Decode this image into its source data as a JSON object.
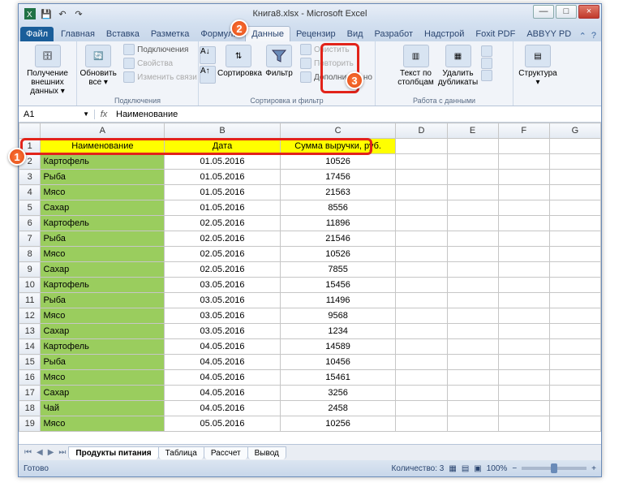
{
  "titlebar": {
    "title": "Книга8.xlsx - Microsoft Excel"
  },
  "winbuttons": {
    "min": "—",
    "max": "□",
    "close": "×"
  },
  "tabs": {
    "file": "Файл",
    "items": [
      "Главная",
      "Вставка",
      "Разметка",
      "Формулы",
      "Данные",
      "Рецензир",
      "Вид",
      "Разработ",
      "Надстрой",
      "Foxit PDF",
      "ABBYY PD"
    ],
    "active": "Данные"
  },
  "ribbon": {
    "g1": {
      "btn": "Получение внешних данных ▾",
      "label": ""
    },
    "g2": {
      "btn": "Обновить все ▾",
      "a": "Подключения",
      "b": "Свойства",
      "c": "Изменить связи",
      "label": "Подключения"
    },
    "g3": {
      "sort": "Сортировка",
      "filter": "Фильтр",
      "a": "Очистить",
      "b": "Повторить",
      "c": "Дополнительно",
      "label": "Сортировка и фильтр"
    },
    "g4": {
      "a": "Текст по столбцам",
      "b": "Удалить дубликаты",
      "label": "Работа с данными"
    },
    "g5": {
      "btn": "Структура ▾"
    }
  },
  "namebox": "A1",
  "formula": "Наименование",
  "cols": [
    "A",
    "B",
    "C",
    "D",
    "E",
    "F",
    "G"
  ],
  "headers": {
    "a": "Наименование",
    "b": "Дата",
    "c": "Сумма выручки, руб."
  },
  "rows": [
    {
      "n": 2,
      "a": "Картофель",
      "b": "01.05.2016",
      "c": "10526"
    },
    {
      "n": 3,
      "a": "Рыба",
      "b": "01.05.2016",
      "c": "17456"
    },
    {
      "n": 4,
      "a": "Мясо",
      "b": "01.05.2016",
      "c": "21563"
    },
    {
      "n": 5,
      "a": "Сахар",
      "b": "01.05.2016",
      "c": "8556"
    },
    {
      "n": 6,
      "a": "Картофель",
      "b": "02.05.2016",
      "c": "11896"
    },
    {
      "n": 7,
      "a": "Рыба",
      "b": "02.05.2016",
      "c": "21546"
    },
    {
      "n": 8,
      "a": "Мясо",
      "b": "02.05.2016",
      "c": "10526"
    },
    {
      "n": 9,
      "a": "Сахар",
      "b": "02.05.2016",
      "c": "7855"
    },
    {
      "n": 10,
      "a": "Картофель",
      "b": "03.05.2016",
      "c": "15456"
    },
    {
      "n": 11,
      "a": "Рыба",
      "b": "03.05.2016",
      "c": "11496"
    },
    {
      "n": 12,
      "a": "Мясо",
      "b": "03.05.2016",
      "c": "9568"
    },
    {
      "n": 13,
      "a": "Сахар",
      "b": "03.05.2016",
      "c": "1234"
    },
    {
      "n": 14,
      "a": "Картофель",
      "b": "04.05.2016",
      "c": "14589"
    },
    {
      "n": 15,
      "a": "Рыба",
      "b": "04.05.2016",
      "c": "10456"
    },
    {
      "n": 16,
      "a": "Мясо",
      "b": "04.05.2016",
      "c": "15461"
    },
    {
      "n": 17,
      "a": "Сахар",
      "b": "04.05.2016",
      "c": "3256"
    },
    {
      "n": 18,
      "a": "Чай",
      "b": "04.05.2016",
      "c": "2458"
    },
    {
      "n": 19,
      "a": "Мясо",
      "b": "05.05.2016",
      "c": "10256"
    }
  ],
  "sheets": [
    "Продукты питания",
    "Таблица",
    "Рассчет",
    "Вывод"
  ],
  "status": {
    "left": "Готово",
    "count_label": "Количество: 3",
    "zoom": "100%"
  },
  "callouts": {
    "a": "1",
    "b": "2",
    "c": "3"
  }
}
